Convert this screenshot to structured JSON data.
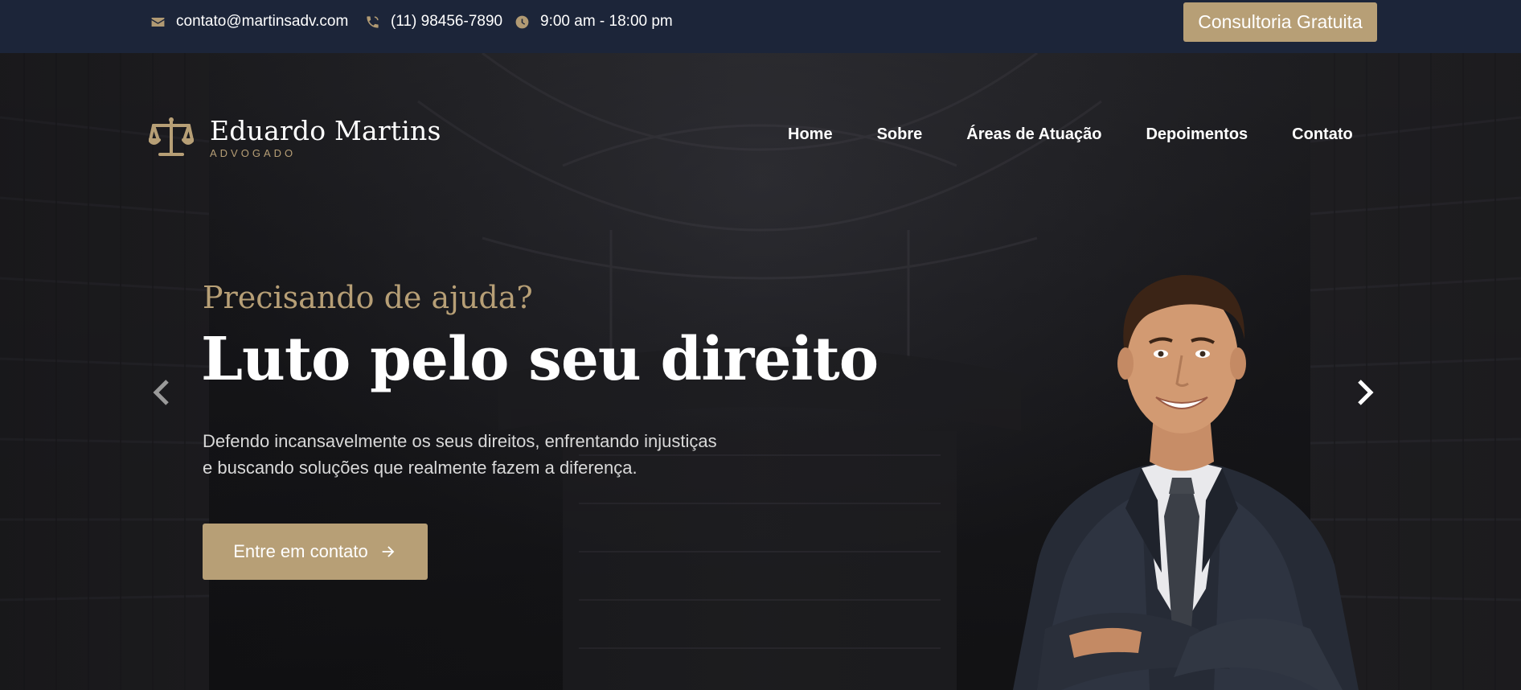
{
  "topbar": {
    "email": "contato@martinsadv.com",
    "phone": "(11) 98456-7890",
    "hours": "9:00 am - 18:00 pm",
    "cta_label": "Consultoria Gratuita",
    "icons": [
      "envelope-icon",
      "phone-icon",
      "clock-icon"
    ]
  },
  "brand": {
    "name": "Eduardo Martins",
    "subtitle": "ADVOGADO",
    "logo_icon": "scales-of-justice-icon"
  },
  "nav": {
    "items": [
      {
        "label": "Home"
      },
      {
        "label": "Sobre"
      },
      {
        "label": "Áreas de Atuação"
      },
      {
        "label": "Depoimentos"
      },
      {
        "label": "Contato"
      }
    ]
  },
  "hero": {
    "kicker": "Precisando de ajuda?",
    "headline": "Luto pelo seu direito",
    "description_line1": "Defendo incansavelmente os seus direitos, enfrentando injustiças",
    "description_line2": "e buscando soluções que realmente fazem a diferença.",
    "cta_label": "Entre em contato",
    "cta_icon": "arrow-right-icon",
    "prev_icon": "chevron-left-icon",
    "next_icon": "chevron-right-icon"
  },
  "colors": {
    "accent": "#b79f76",
    "topbar": "#1c2539",
    "text": "#ffffff"
  }
}
